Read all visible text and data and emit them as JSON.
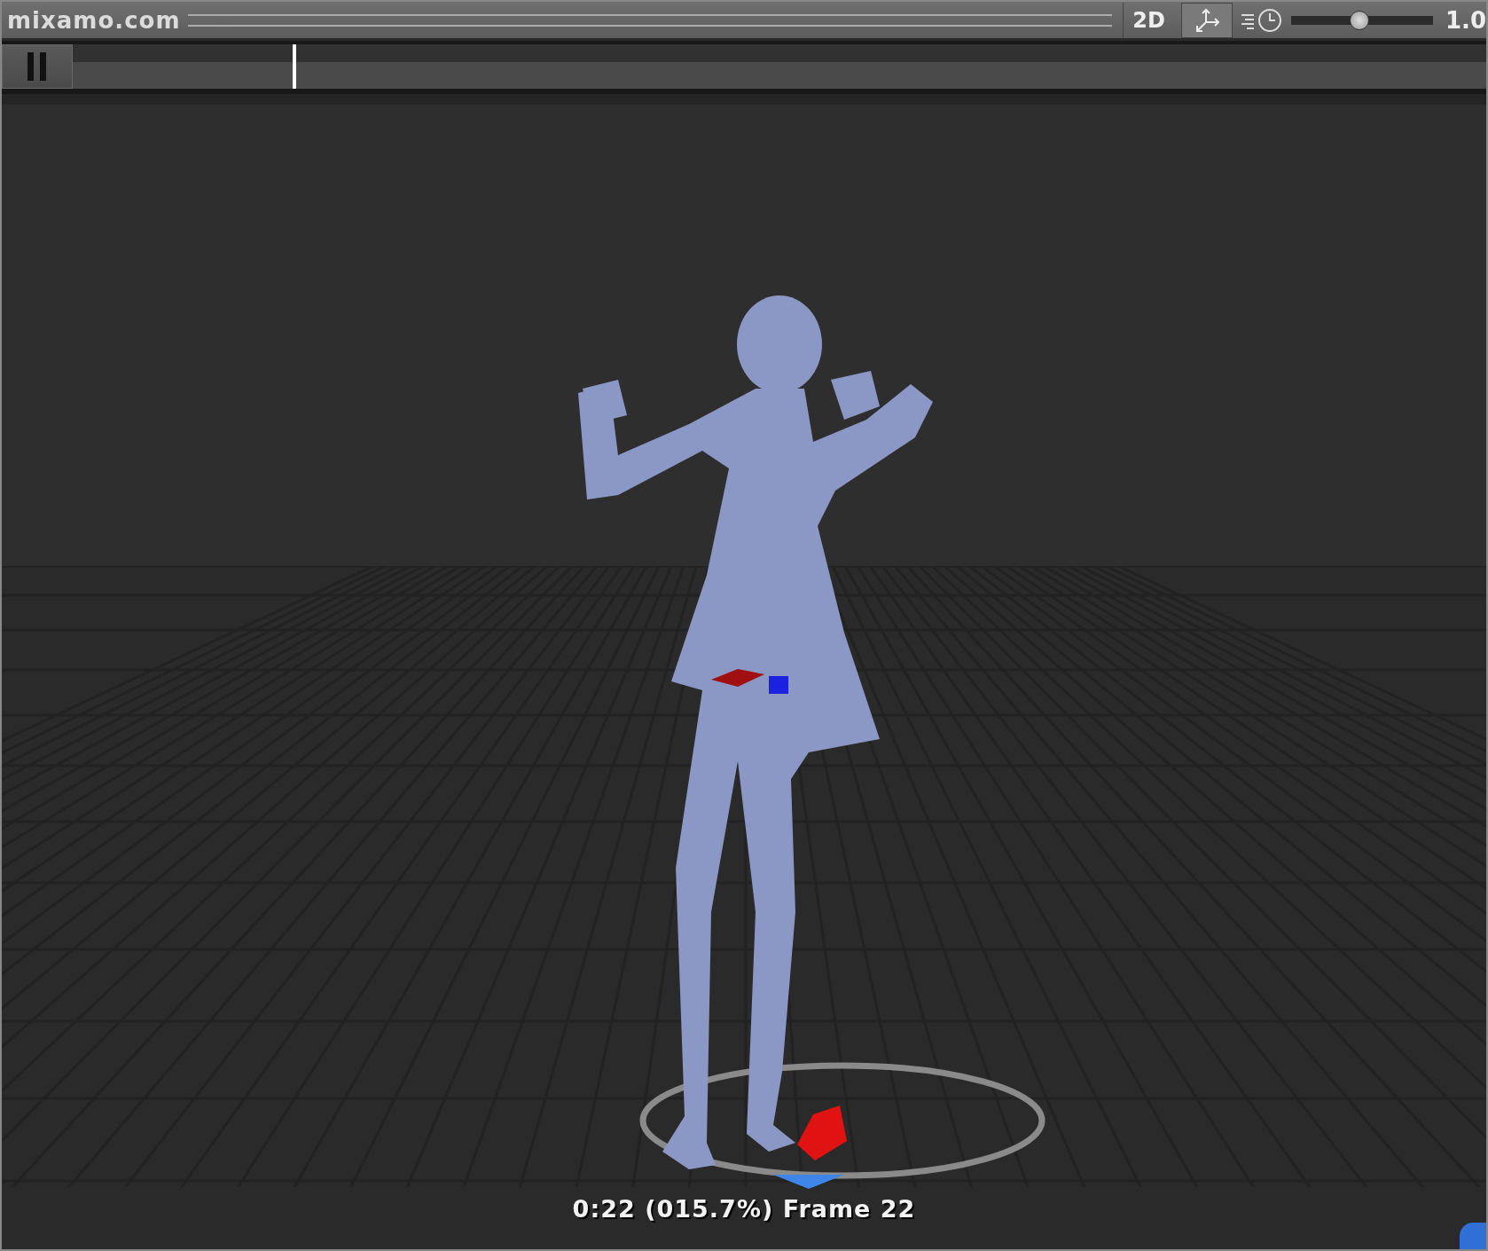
{
  "toolbar": {
    "title": "mixamo.com",
    "mode_button": "2D",
    "pivot_button_selected": true,
    "speed_slider": {
      "level": 0.48
    },
    "speed_value": "1.0"
  },
  "timeline": {
    "playing": true,
    "level": 0.157
  },
  "viewport": {
    "caption": "0:22 (015.7%) Frame 22"
  }
}
